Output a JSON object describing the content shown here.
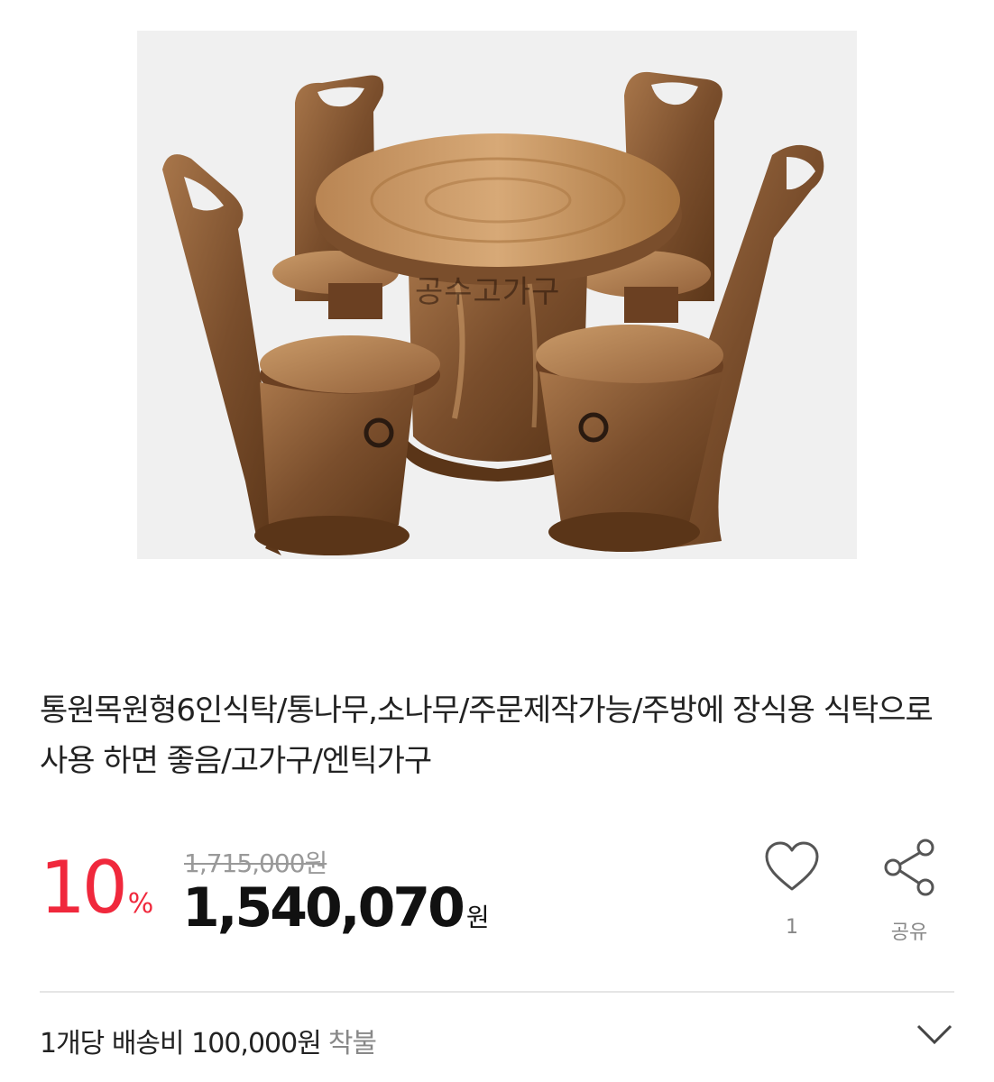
{
  "product": {
    "image_watermark": "공수고가구",
    "title": "통원목원형6인식탁/통나무,소나무/주문제작가능/주방에 장식용 식탁으로 사용 하면 좋음/고가구/엔틱가구"
  },
  "price": {
    "discount_value": "10",
    "discount_symbol": "%",
    "original_price": "1,715,000원",
    "sale_price": "1,540,070",
    "sale_unit": "원",
    "discount_color": "#f0283c"
  },
  "actions": {
    "like_icon": "heart-icon",
    "like_count": "1",
    "share_icon": "share-icon",
    "share_label": "공유"
  },
  "shipping": {
    "text": "1개당 배송비 100,000원",
    "method": "착불",
    "expand_icon": "chevron-down-icon"
  }
}
